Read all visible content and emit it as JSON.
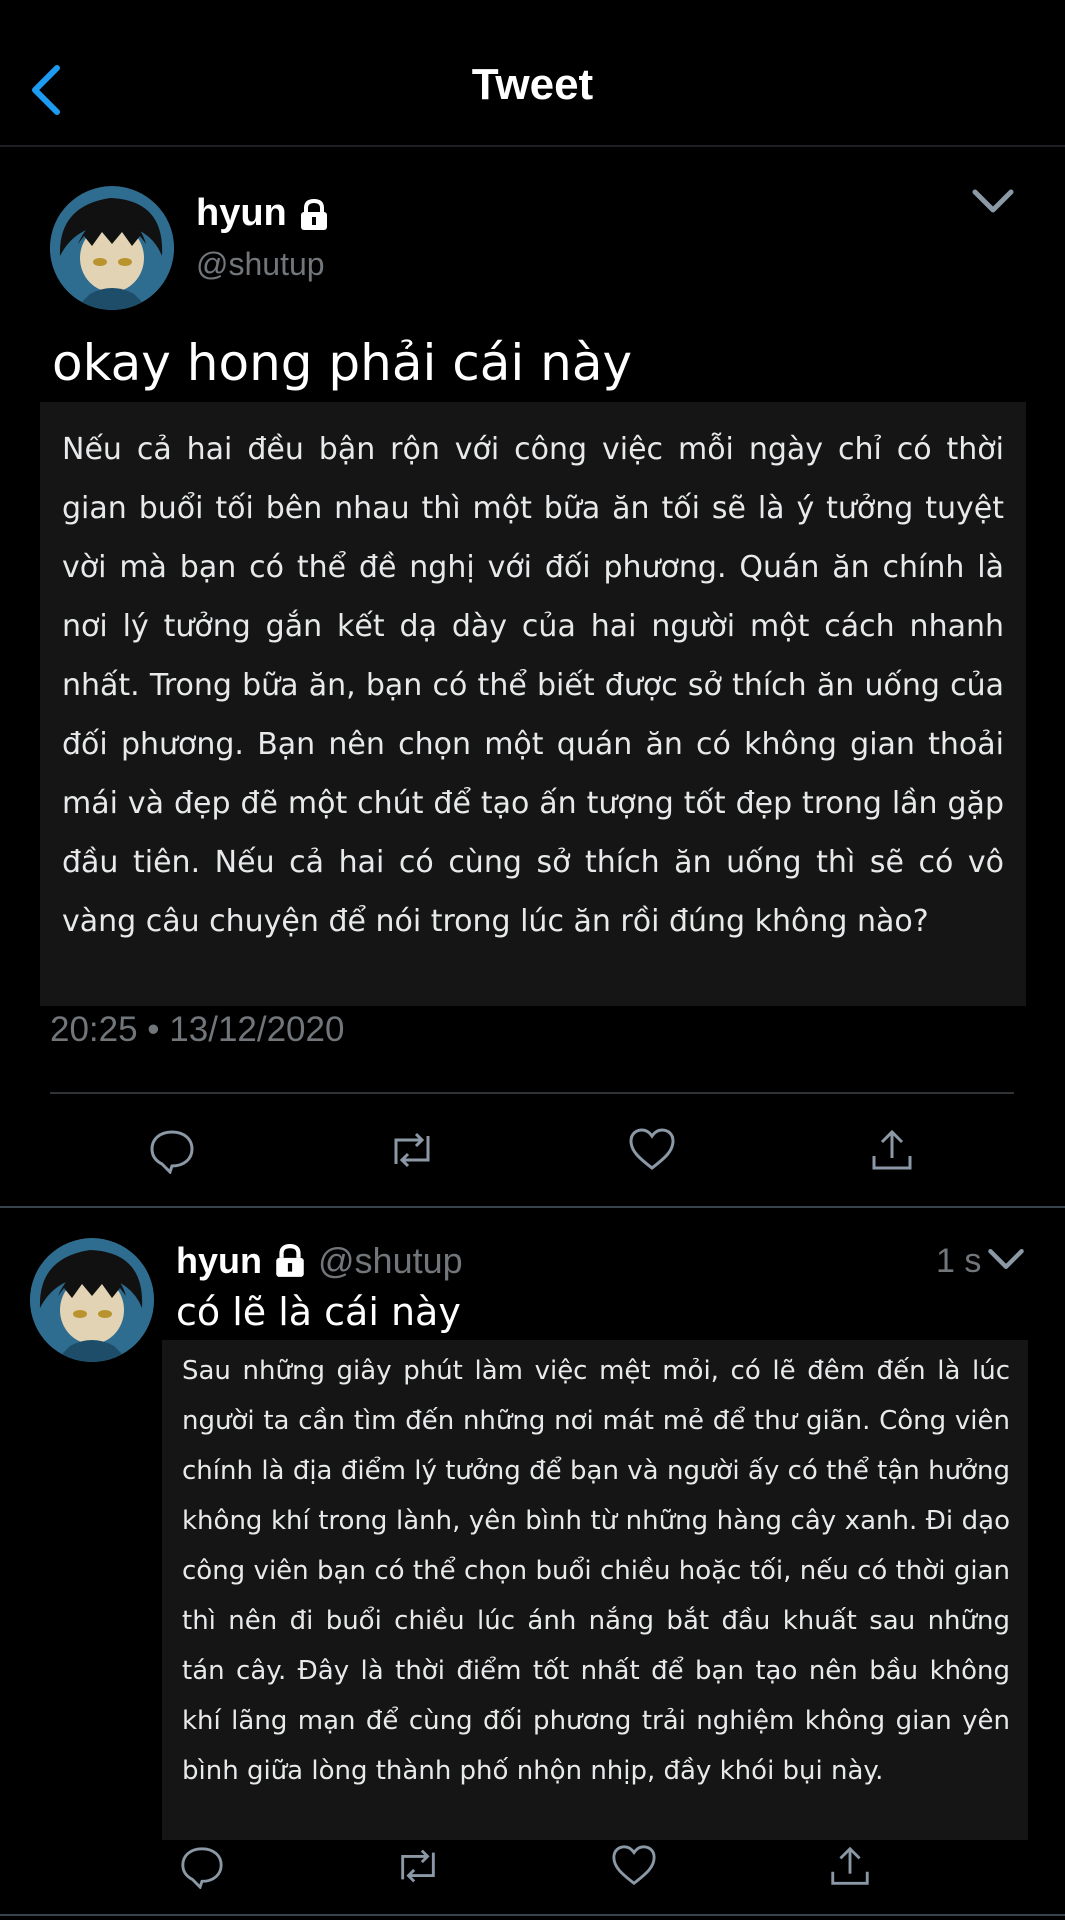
{
  "header": {
    "title": "Tweet"
  },
  "main_tweet": {
    "name": "hyun",
    "handle": "@shutup",
    "title": "okay hong phải cái này",
    "body": "Nếu cả hai đều bận rộn với công việc mỗi ngày chỉ có thời gian buổi tối bên nhau thì một bữa ăn tối sẽ là ý tưởng tuyệt vời mà bạn có thể đề nghị với đối phương. Quán ăn chính là nơi lý tưởng gắn kết dạ dày của hai người một cách nhanh nhất. Trong bữa ăn, bạn có thể biết được sở thích ăn uống của đối phương. Bạn nên chọn một quán ăn có không gian thoải mái và đẹp đẽ một chút để tạo ấn tượng tốt đẹp trong lần gặp đầu tiên. Nếu cả hai có cùng sở thích ăn uống thì sẽ có vô vàng câu chuyện để nói trong lúc ăn rồi đúng không nào?",
    "timestamp": "20:25 • 13/12/2020"
  },
  "reply": {
    "name": "hyun",
    "handle": "@shutup",
    "time": "1 s",
    "title": "có lẽ là cái này",
    "body": "Sau những giây phút làm việc mệt mỏi, có lẽ đêm đến là lúc người ta cần tìm đến những nơi mát mẻ để thư giãn. Công viên chính là địa điểm lý tưởng để bạn và người ấy có thể tận hưởng không khí trong lành, yên bình từ những hàng cây xanh. Đi dạo công viên bạn có thể chọn buổi chiều hoặc tối, nếu có thời gian thì nên đi buổi chiều lúc ánh nắng bắt đầu khuất sau những tán cây. Đây là thời điểm tốt nhất để bạn tạo nên bầu không khí lãng mạn để cùng đối phương trải nghiệm không gian yên bình giữa lòng thành phố nhộn nhịp, đầy khói bụi này."
  },
  "icons": [
    "back-icon",
    "lock-icon",
    "chevron-down-icon",
    "reply-icon",
    "retweet-icon",
    "like-icon",
    "share-icon"
  ],
  "colors": {
    "background": "#000000",
    "accent": "#1d9bf0",
    "muted": "#71767b",
    "quote_bg": "#151515"
  }
}
